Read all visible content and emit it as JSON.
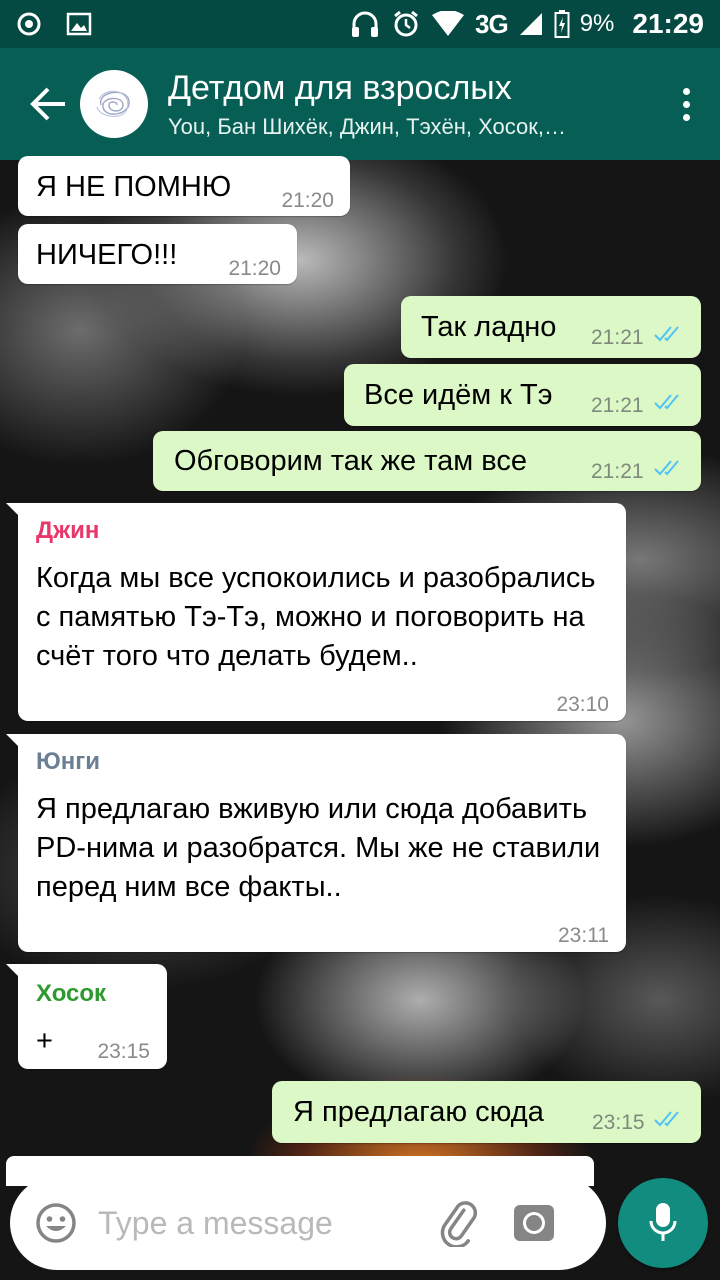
{
  "status_bar": {
    "icons": [
      "notification-dot-icon",
      "image-icon",
      "headphones-icon",
      "alarm-icon",
      "wifi-icon",
      "signal-icon",
      "battery-icon"
    ],
    "network": "3G",
    "battery": "9%",
    "time": "21:29"
  },
  "header": {
    "title": "Детдом для взрослых",
    "subtitle": "You, Бан Шихёк, Джин, Тэхён, Хосок,…"
  },
  "messages": [
    {
      "type": "in",
      "text": "Я НЕ ПОМНЮ",
      "time": "21:20"
    },
    {
      "type": "in",
      "text": "НИЧЕГО!!!",
      "time": "21:20"
    },
    {
      "type": "out",
      "text": "Так ладно",
      "time": "21:21",
      "status": "read"
    },
    {
      "type": "out",
      "text": "Все идём к Тэ",
      "time": "21:21",
      "status": "read"
    },
    {
      "type": "out",
      "text": "Обговорим так же там все",
      "time": "21:21",
      "status": "read"
    },
    {
      "type": "in",
      "sender": "Джин",
      "sender_color": "#e8386b",
      "text": "Когда мы все успокоились и разобрались с памятью Тэ-Тэ, можно и поговорить на счёт того что делать будем..",
      "time": "23:10"
    },
    {
      "type": "in",
      "sender": "Юнги",
      "sender_color": "#6a7e94",
      "text": "Я предлагаю вживую или сюда добавить PD-нима и разобратся. Мы же не ставили перед ним все факты..",
      "time": "23:11"
    },
    {
      "type": "in",
      "sender": "Хосок",
      "sender_color": "#2e9a2e",
      "text": "+",
      "time": "23:15"
    },
    {
      "type": "out",
      "text": "Я предлагаю сюда",
      "time": "23:15",
      "status": "read"
    }
  ],
  "composer": {
    "placeholder": "Type a message"
  },
  "colors": {
    "status_bar": "#044a42",
    "app_bar": "#075e54",
    "outgoing_bubble": "#dcf8c6",
    "incoming_bubble": "#ffffff",
    "read_ticks": "#4fc3f7",
    "mic_button": "#128c7e"
  }
}
